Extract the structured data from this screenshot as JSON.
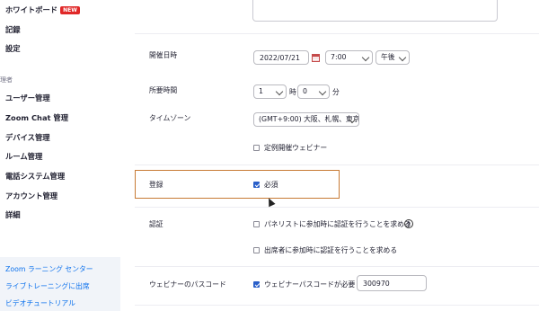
{
  "sidebar": {
    "items": [
      {
        "label": "ホワイトボード",
        "badge": "NEW"
      },
      {
        "label": "記録"
      },
      {
        "label": "設定"
      }
    ],
    "section_label": "理者",
    "admin_items": [
      {
        "label": "ユーザー管理"
      },
      {
        "label": "Zoom Chat 管理"
      },
      {
        "label": "デバイス管理"
      },
      {
        "label": "ルーム管理"
      },
      {
        "label": "電話システム管理"
      },
      {
        "label": "アカウント管理"
      },
      {
        "label": "詳細"
      }
    ],
    "footer_links": [
      {
        "label": "Zoom ラーニング センター"
      },
      {
        "label": "ライブトレーニングに出席"
      },
      {
        "label": "ビデオチュートリアル"
      }
    ]
  },
  "form": {
    "datetime": {
      "label": "開催日時",
      "date": "2022/07/21",
      "time": "7:00",
      "ampm": "午後"
    },
    "duration": {
      "label": "所要時間",
      "hours": "1",
      "hours_unit": "時",
      "minutes": "0",
      "minutes_unit": "分"
    },
    "timezone": {
      "label": "タイムゾーン",
      "value": "(GMT+9:00) 大阪、札幌、東京"
    },
    "recurring": {
      "label": "定例開催ウェビナー",
      "checked": false
    },
    "registration": {
      "label": "登録",
      "required_label": "必須",
      "checked": true
    },
    "auth": {
      "label": "認証",
      "panelist_label": "パネリストに参加時に認証を行うことを求める",
      "panelist_checked": false,
      "attendee_label": "出席者に参加時に認証を行うことを求める",
      "attendee_checked": false,
      "help_icon": "?"
    },
    "passcode": {
      "label": "ウェビナーのパスコード",
      "required_label": "ウェビナーパスコードが必要",
      "checked": true,
      "value": "300970"
    }
  },
  "colors": {
    "accent": "#0e72ed",
    "badge": "#e02828",
    "highlight_border": "#c77a34",
    "checkbox": "#2a5fc9"
  }
}
